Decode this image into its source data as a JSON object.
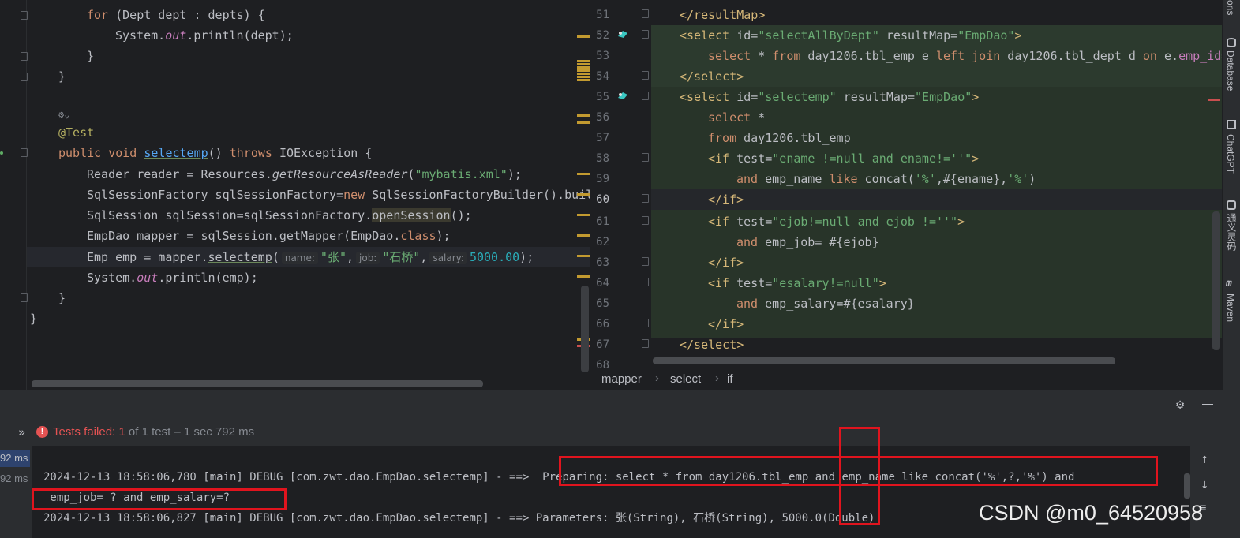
{
  "left_editor": {
    "line_for": [
      "for",
      " (Dept dept : depts) {"
    ],
    "line_sysout1": [
      "System.",
      "out",
      ".println(dept);"
    ],
    "brace1": "}",
    "brace2": "}",
    "annotation_test": "@Test",
    "sig": {
      "kw1": "public",
      "kw2": "void",
      "name": "selectemp",
      "rest1": "() ",
      "kw3": "throws",
      "rest2": " IOException {"
    },
    "reader_line": {
      "a": "Reader reader = Resources.",
      "b": "getResourceAsReader",
      "c": "(",
      "d": "\"mybatis.xml\"",
      "e": ");"
    },
    "factory_line": {
      "a": "SqlSessionFactory sqlSessionFactory=",
      "b": "new",
      "c": " SqlSessionFactoryBuilder().buil"
    },
    "session_line": {
      "a": "SqlSession sqlSession=sqlSessionFactory.",
      "b": "openSession",
      "c": "();"
    },
    "mapper_line": {
      "a": "EmpDao mapper = sqlSession.getMapper(EmpDao.",
      "b": "class",
      "c": ");"
    },
    "emp_line": {
      "a": "Emp emp = mapper.",
      "b": "selectemp",
      "c": "(",
      "hint1": "name:",
      "v1": "\"张\"",
      "comma1": ",",
      "hint2": "job:",
      "v2": "\"石桥\"",
      "comma2": ",",
      "hint3": "salary:",
      "v3": "5000.00",
      "end": ");"
    },
    "sysout_line": {
      "a": "System.",
      "b": "out",
      "c": ".println(emp);"
    },
    "brace3": "}",
    "brace4": "}"
  },
  "right_editor": {
    "line_numbers": [
      "51",
      "52",
      "53",
      "54",
      "55",
      "56",
      "57",
      "58",
      "59",
      "60",
      "61",
      "62",
      "63",
      "64",
      "65",
      "66",
      "67",
      "68"
    ],
    "l51": "</resultMap>",
    "l52": {
      "open": "<select ",
      "a1": "id=",
      "v1": "\"selectAllByDept\"",
      "a2": " resultMap=",
      "v2": "\"EmpDao\"",
      "close": ">"
    },
    "l53": {
      "k1": "select",
      "s1": " * ",
      "k2": "from",
      "s2": " day1206.tbl_emp e ",
      "k3": "left join",
      "s3": " day1206.tbl_dept d ",
      "k4": "on",
      "s4": " e.",
      "c1": "emp_id="
    },
    "l54": "</select>",
    "l55": {
      "open": "<select ",
      "a1": "id=",
      "v1": "\"selectemp\"",
      "a2": " resultMap=",
      "v2": "\"EmpDao\"",
      "close": ">"
    },
    "l56": {
      "k": "select",
      "s": " *"
    },
    "l57": {
      "k": "from",
      "s": " day1206.tbl_emp"
    },
    "l58": {
      "open": "<if ",
      "a": "test=",
      "v": "\"ename !=null and ename!=''\"",
      "close": ">"
    },
    "l59": {
      "k1": "and",
      "s1": " emp_name ",
      "k2": "like",
      "s2": " concat(",
      "q1": "'%'",
      "s3": ",#{ename},",
      "q2": "'%'",
      "s4": ")"
    },
    "l60": "</if>",
    "l61": {
      "open": "<if ",
      "a": "test=",
      "v": "\"ejob!=null and ejob !=''\"",
      "close": ">"
    },
    "l62": {
      "k": "and",
      "s": " emp_job= #{ejob}"
    },
    "l63": "</if>",
    "l64": {
      "open": "<if ",
      "a": "test=",
      "v": "\"esalary!=null\"",
      "close": ">"
    },
    "l65": {
      "k": "and",
      "s": " emp_salary=#{esalary}"
    },
    "l66": "</if>",
    "l67": "</select>",
    "breadcrumb": [
      "mapper",
      "select",
      "if"
    ]
  },
  "tool_strip": [
    "ons",
    "Database",
    "ChatGPT",
    "通义灵码",
    "Maven"
  ],
  "run_panel": {
    "status_prefix": "»",
    "status_failed": "Tests failed: 1",
    "status_rest": " of 1 test – 1 sec 792 ms",
    "left_timings": [
      "92 ms",
      "92 ms"
    ],
    "log_line1_prefix": "2024-12-13 18:58:06,780 [main] DEBUG [com.zwt.dao.EmpDao.selectemp] - ==> ",
    "log_line1_sql": " Preparing: select * from day1206.tbl_emp and emp_name like concat('%',?,'%') and",
    "log_line2": " emp_job= ? and emp_salary=?",
    "log_line3": "2024-12-13 18:58:06,827 [main] DEBUG [com.zwt.dao.EmpDao.selectemp] - ==> Parameters: 张(String), 石桥(String), 5000.0(Double)",
    "watermark": "CSDN @m0_64520958"
  },
  "colors": {
    "error_red": "#e0141e",
    "accent_blue": "#56a8f5"
  }
}
